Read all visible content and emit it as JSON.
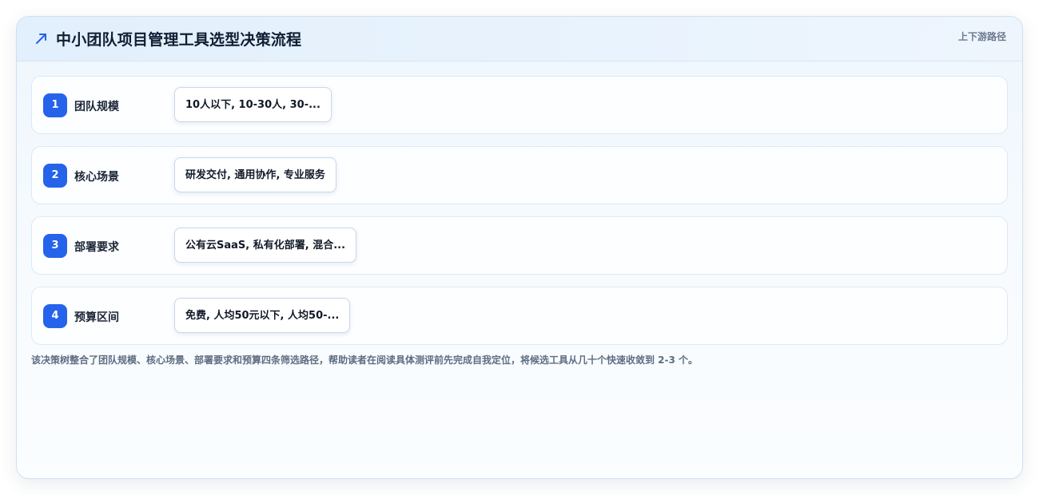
{
  "header": {
    "icon": "trend-arrow-icon",
    "title": "中小团队项目管理工具选型决策流程",
    "tag": "上下游路径"
  },
  "colors": {
    "accent": "#2563eb",
    "card_border": "#cfe0f1"
  },
  "steps": [
    {
      "number": "1",
      "label": "团队规模",
      "chip": "10人以下, 10-30人, 30-..."
    },
    {
      "number": "2",
      "label": "核心场景",
      "chip": "研发交付, 通用协作, 专业服务"
    },
    {
      "number": "3",
      "label": "部署要求",
      "chip": "公有云SaaS, 私有化部署, 混合..."
    },
    {
      "number": "4",
      "label": "预算区间",
      "chip": "免费, 人均50元以下, 人均50-..."
    }
  ],
  "caption": "该决策树整合了团队规模、核心场景、部署要求和预算四条筛选路径，帮助读者在阅读具体测评前先完成自我定位，将候选工具从几十个快速收敛到 2-3 个。"
}
